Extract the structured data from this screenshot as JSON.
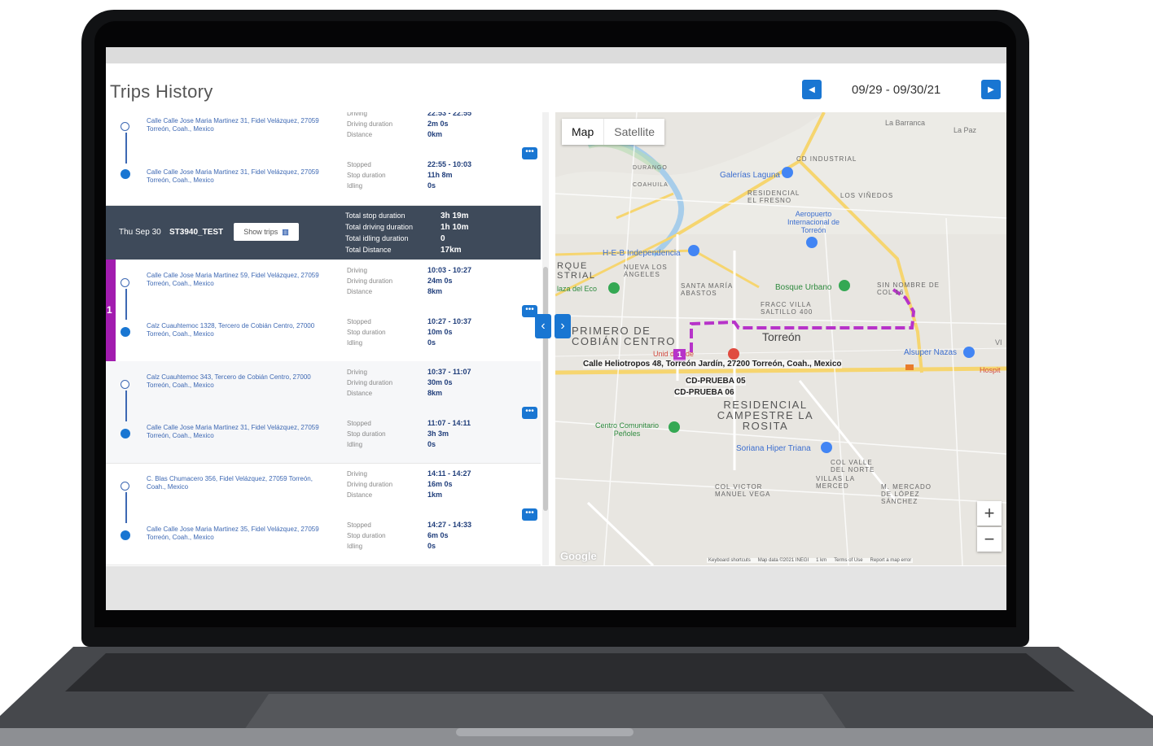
{
  "title": "Trips History",
  "date_range": "09/29 - 09/30/21",
  "colors": {
    "accent": "#1976d2",
    "route": "#b733c9",
    "summary_bg": "#3e4a5a"
  },
  "prev_icon": "chevron-left-icon",
  "next_icon": "chevron-right-icon",
  "labels": {
    "driving": "Driving",
    "driving_duration": "Driving duration",
    "distance": "Distance",
    "stopped": "Stopped",
    "stop_duration": "Stop duration",
    "idling": "Idling"
  },
  "trips_before": {
    "driving_time": "22:53 - 22:55",
    "driving_duration": "2m 0s",
    "distance": "0km",
    "stopped_time": "22:55 - 10:03",
    "stop_duration": "11h 8m",
    "idling": "0s",
    "start_address": "Calle Calle Jose Maria Martinez 31, Fidel Velázquez, 27059 Torreón, Coah., Mexico",
    "end_address": "Calle Calle Jose Maria Martinez 31, Fidel Velázquez, 27059 Torreón, Coah., Mexico"
  },
  "summary": {
    "date": "Thu Sep 30",
    "device": "ST3940_TEST",
    "show_trips": "Show trips",
    "rows": [
      {
        "label": "Total stop duration",
        "value": "3h 19m"
      },
      {
        "label": "Total driving duration",
        "value": "1h 10m"
      },
      {
        "label": "Total idling duration",
        "value": "0"
      },
      {
        "label": "Total Distance",
        "value": "17km"
      }
    ]
  },
  "trips": [
    {
      "index": "1",
      "start_address": "Calle Calle Jose Maria Martinez 59, Fidel Velázquez, 27059 Torreón, Coah., Mexico",
      "end_address": "Calz Cuauhtemoc 1328, Tercero de Cobián Centro, 27000 Torreón, Coah., Mexico",
      "driving_time": "10:03 - 10:27",
      "driving_duration": "24m 0s",
      "distance": "8km",
      "stopped_time": "10:27 - 10:37",
      "stop_duration": "10m 0s",
      "idling": "0s"
    },
    {
      "index": "",
      "start_address": "Calz Cuauhtemoc 343, Tercero de Cobián Centro, 27000 Torreón, Coah., Mexico",
      "end_address": "Calle Calle Jose Maria Martinez 31, Fidel Velázquez, 27059 Torreón, Coah., Mexico",
      "driving_time": "10:37 - 11:07",
      "driving_duration": "30m 0s",
      "distance": "8km",
      "stopped_time": "11:07 - 14:11",
      "stop_duration": "3h 3m",
      "idling": "0s"
    },
    {
      "index": "",
      "start_address": "C. Blas Chumacero 356, Fidel Velázquez, 27059 Torreón, Coah., Mexico",
      "end_address": "Calle Calle Jose Maria Martinez 35, Fidel Velázquez, 27059 Torreón, Coah., Mexico",
      "driving_time": "14:11 - 14:27",
      "driving_duration": "16m 0s",
      "distance": "1km",
      "stopped_time": "14:27 - 14:33",
      "stop_duration": "6m 0s",
      "idling": "0s"
    }
  ],
  "map": {
    "tab_map": "Map",
    "tab_satellite": "Satellite",
    "zoom_in": "+",
    "zoom_out": "−",
    "marker_label": "1",
    "popup_address": "Calle Heliotropos 48, Torreón Jardín, 27200 Torreón, Coah., Mexico",
    "marker_a": "CD-PRUEBA 05",
    "marker_b": "CD-PRUEBA 06",
    "google": "Google",
    "footer": [
      "Keyboard shortcuts",
      "Map data ©2021 INEGI",
      "1 km",
      "Terms of Use",
      "Report a map error"
    ],
    "places": {
      "torreon": "Torreón",
      "primero": "PRIMERO DE COBIÁN CENTRO",
      "residencial": "RESIDENCIAL CAMPESTRE LA ROSITA",
      "galerias": "Galerías Laguna",
      "aeropuerto": "Aeropuerto Internacional de Torreón",
      "heb": "H-E-B Independencia",
      "bosque": "Bosque Urbano",
      "alsuper": "Alsuper Nazas",
      "soriana": "Soriana Hiper Triana",
      "centro": "Centro Comunitario Peñoles",
      "ci_industrial": "CD INDUSTRIAL",
      "residencial_fresno": "RESIDENCIAL EL FRESNO",
      "los_vinedos": "LOS VIÑEDOS",
      "la_barranca": "La Barranca",
      "la_paz": "La Paz",
      "santa_maria": "SANTA MARÍA ABASTOS",
      "nueva_los_angeles": "NUEVA LOS ÁNGELES",
      "fracc_villa": "FRACC VILLA SALTILLO 400",
      "sin_nombre": "SIN NOMBRE DE COL 16",
      "col_valle": "COL VALLE DEL NORTE",
      "col_victor": "COL VICTOR MANUEL VEGA",
      "villas": "VILLAS LA MERCED",
      "mercado": "M. MERCADO DE LÓPEZ SÁNCHEZ",
      "durango": "DURANGO",
      "coahuila": "COAHUILA",
      "strial": "RQUE STRIAL",
      "plaza": "laza del Eco",
      "unidad": "Unid dica de",
      "hospit": "Hospit",
      "vi": "VI"
    }
  }
}
